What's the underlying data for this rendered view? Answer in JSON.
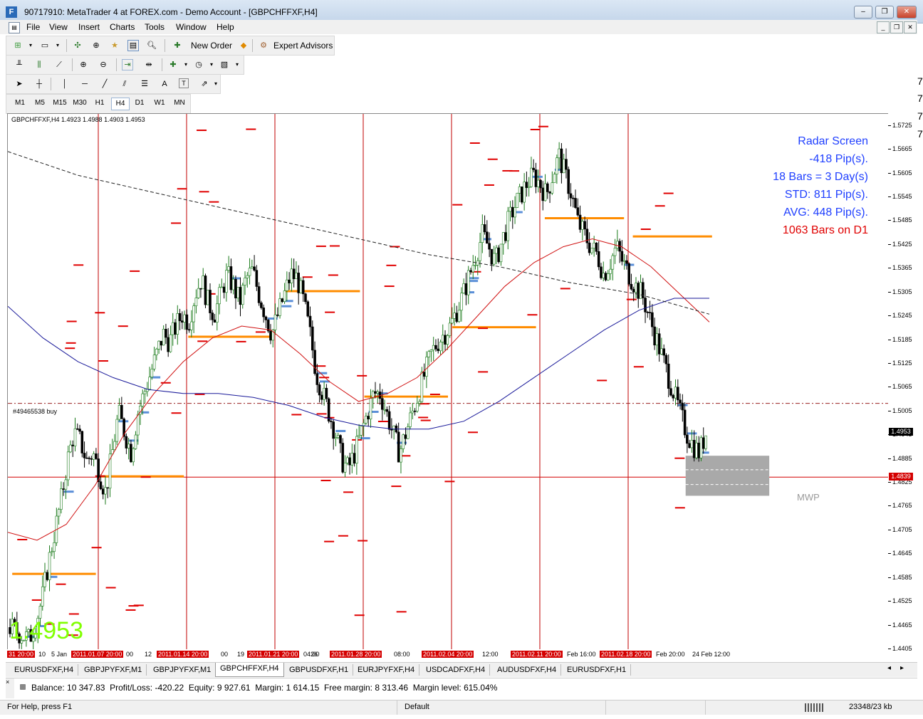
{
  "window": {
    "title": "90717910: MetaTrader 4 at FOREX.com - Demo Account - [GBPCHFFXF,H4]",
    "app_icon": "F",
    "minimize": "–",
    "restore": "❐",
    "close": "✕"
  },
  "menu": [
    "File",
    "View",
    "Insert",
    "Charts",
    "Tools",
    "Window",
    "Help"
  ],
  "toolbar": {
    "new_order": "New Order",
    "expert_advisors": "Expert Advisors"
  },
  "timeframes": [
    "M1",
    "M5",
    "M15",
    "M30",
    "H1",
    "H4",
    "D1",
    "W1",
    "MN"
  ],
  "active_timeframe": "H4",
  "chart": {
    "header": "GBPCHFFXF,H4  1.4923 1.4988 1.4903 1.4953",
    "order_label": "#49465538 buy",
    "big_price": "1.4953",
    "mwp_label": "MWP",
    "radar": {
      "title": "Radar Screen",
      "pips": "-418 Pip(s).",
      "bars": "18 Bars = 3 Day(s)",
      "std": "STD: 811 Pip(s).",
      "avg": "AVG: 448 Pip(s).",
      "d1_bars": "1063 Bars on D1"
    },
    "current_price": "1.4953",
    "order_price": "1.4839",
    "right_edge_digits": [
      "7",
      "7",
      "7",
      "7"
    ]
  },
  "chart_data": {
    "type": "candlestick",
    "symbol": "GBPCHFFXF",
    "timeframe": "H4",
    "ohlc_last": {
      "open": 1.4923,
      "high": 1.4988,
      "low": 1.4903,
      "close": 1.4953
    },
    "y_ticks": [
      "1.5725",
      "1.5665",
      "1.5605",
      "1.5545",
      "1.5485",
      "1.5425",
      "1.5365",
      "1.5305",
      "1.5245",
      "1.5185",
      "1.5125",
      "1.5065",
      "1.5005",
      "1.4945",
      "1.4885",
      "1.4825",
      "1.4765",
      "1.4705",
      "1.4645",
      "1.4585",
      "1.4525",
      "1.4465",
      "1.4405"
    ],
    "x_labels": [
      "31 20:00",
      "5 Jan",
      "2011.01.07 20:00",
      "12",
      "2011.01.14 20:00",
      "19",
      "2011.01.21 20:00",
      "26",
      "2011.01.28 20:00",
      "2011.02.04 20:00",
      "2011.02.11 20:00",
      "2011.02.18 20:00",
      "24 Feb 12:00"
    ],
    "x_label_fragments": [
      "10",
      "00",
      "00",
      "04:00",
      "08:00",
      "12:00",
      "Feb 16:00",
      "Feb 20:00"
    ],
    "x_label_red": [
      "31 20:00",
      "2011.01.07 20:00",
      "2011.01.14 20:00",
      "2011.01.21 20:00",
      "2011.01.28 20:00",
      "2011.02.04 20:00",
      "2011.02.11 20:00",
      "2011.02.18 20:00"
    ],
    "ylim": [
      1.4405,
      1.5755
    ],
    "last_price": 1.4953,
    "order_level": 1.4839,
    "buy_order_level": 1.5025,
    "weekly_separators": 7,
    "bar_count": 300,
    "candle_path": [
      1.446,
      1.445,
      1.444,
      1.443,
      1.447,
      1.453,
      1.462,
      1.47,
      1.478,
      1.488,
      1.495,
      1.493,
      1.488,
      1.49,
      1.485,
      1.48,
      1.49,
      1.5,
      1.495,
      1.49,
      1.5,
      1.505,
      1.51,
      1.515,
      1.52,
      1.518,
      1.522,
      1.525,
      1.523,
      1.53,
      1.534,
      1.528,
      1.525,
      1.53,
      1.535,
      1.532,
      1.528,
      1.534,
      1.536,
      1.53,
      1.525,
      1.52,
      1.525,
      1.53,
      1.535,
      1.534,
      1.528,
      1.52,
      1.51,
      1.505,
      1.5,
      1.495,
      1.488,
      1.486,
      1.49,
      1.495,
      1.5,
      1.505,
      1.505,
      1.5,
      1.495,
      1.49,
      1.495,
      1.5,
      1.505,
      1.51,
      1.515,
      1.518,
      1.52,
      1.522,
      1.526,
      1.53,
      1.535,
      1.54,
      1.545,
      1.542,
      1.538,
      1.543,
      1.548,
      1.552,
      1.555,
      1.558,
      1.56,
      1.558,
      1.555,
      1.56,
      1.565,
      1.56,
      1.555,
      1.548,
      1.545,
      1.542,
      1.54,
      1.535,
      1.538,
      1.542,
      1.538,
      1.535,
      1.532,
      1.53,
      1.525,
      1.52,
      1.515,
      1.51,
      1.505,
      1.5,
      1.495,
      1.492,
      1.49,
      1.495
    ],
    "ma_red_path": [
      1.47,
      1.468,
      1.472,
      1.482,
      1.495,
      1.505,
      1.513,
      1.519,
      1.522,
      1.521,
      1.515,
      1.508,
      1.503,
      1.505,
      1.509,
      1.516,
      1.524,
      1.532,
      1.538,
      1.542,
      1.544,
      1.542,
      1.537,
      1.53,
      1.523
    ],
    "ma_blue_path": [
      1.527,
      1.519,
      1.513,
      1.509,
      1.506,
      1.505,
      1.505,
      1.504,
      1.502,
      1.499,
      1.497,
      1.496,
      1.496,
      1.498,
      1.503,
      1.509,
      1.515,
      1.521,
      1.526,
      1.529,
      1.529
    ],
    "ma_black_path": [
      1.566,
      1.56,
      1.556,
      1.552,
      1.548,
      1.544,
      1.54,
      1.537,
      1.533,
      1.53,
      1.525
    ],
    "orange_levels": [
      {
        "x0": 0.005,
        "x1": 0.1,
        "y": 1.4595
      },
      {
        "x0": 0.105,
        "x1": 0.2,
        "y": 1.4841
      },
      {
        "x0": 0.205,
        "x1": 0.3,
        "y": 1.5193
      },
      {
        "x0": 0.315,
        "x1": 0.4,
        "y": 1.5308
      },
      {
        "x0": 0.405,
        "x1": 0.5,
        "y": 1.5042
      },
      {
        "x0": 0.505,
        "x1": 0.6,
        "y": 1.5217
      },
      {
        "x0": 0.61,
        "x1": 0.7,
        "y": 1.5492
      },
      {
        "x0": 0.71,
        "x1": 0.8,
        "y": 1.5446
      }
    ],
    "mwp_box": {
      "x0": 0.77,
      "x1": 0.865,
      "y_top": 1.4893,
      "y_bottom": 1.4792
    }
  },
  "symbol_tabs": [
    "EURUSDFXF,H4",
    "GBPJPYFXF,M1",
    "GBPJPYFXF,M1",
    "GBPCHFFXF,H4",
    "GBPUSDFXF,H1",
    "EURJPYFXF,H4",
    "USDCADFXF,H4",
    "AUDUSDFXF,H4",
    "EURUSDFXF,H1"
  ],
  "active_tab": "GBPCHFFXF,H4",
  "terminal": {
    "balance": "Balance: 10 347.83",
    "pl": "Profit/Loss: -420.22",
    "equity": "Equity: 9 927.61",
    "margin": "Margin: 1 614.15",
    "free_margin": "Free margin: 8 313.46",
    "margin_level": "Margin level: 615.04%"
  },
  "status": {
    "help": "For Help, press F1",
    "profile": "Default",
    "traffic": "23348/23 kb"
  },
  "colors": {
    "up_candle": "#ffffff",
    "down_candle": "#000000",
    "separator": "#c00000",
    "ma_red": "#d01010",
    "ma_blue": "#1a1a9a",
    "orange": "#ff8c00",
    "radar_blue": "#2040ff",
    "radar_red": "#e00000",
    "big_price": "#80ff00"
  }
}
